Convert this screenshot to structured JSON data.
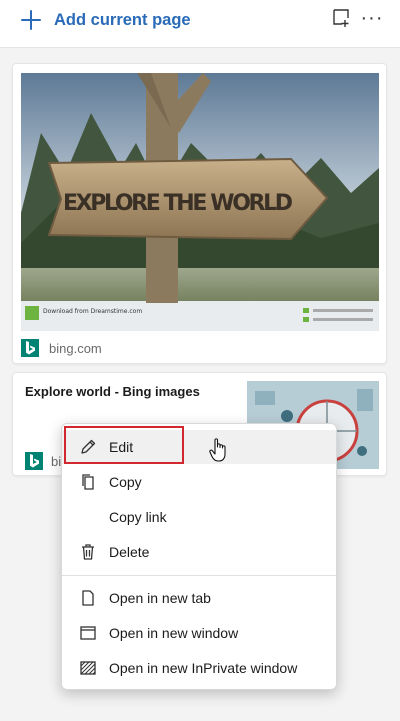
{
  "toolbar": {
    "add_label": "Add current page",
    "accent": "#2a6bb8"
  },
  "cards": [
    {
      "source": "bing.com",
      "image_text": "EXPLORE THE WORLD",
      "watermark": "Download from Dreamstime.com"
    },
    {
      "title": "Explore world - Bing images",
      "source": "bing.com"
    }
  ],
  "menu": {
    "items": [
      {
        "label": "Edit",
        "icon": "pencil-icon"
      },
      {
        "label": "Copy",
        "icon": "copy-icon"
      },
      {
        "label": "Copy link",
        "icon": ""
      },
      {
        "label": "Delete",
        "icon": "trash-icon"
      },
      {
        "label": "Open in new tab",
        "icon": "page-icon"
      },
      {
        "label": "Open in new window",
        "icon": "window-icon"
      },
      {
        "label": "Open in new InPrivate window",
        "icon": "inprivate-window-icon"
      }
    ]
  },
  "colors": {
    "bing_teal": "#008373",
    "highlight_red": "#d1272f"
  }
}
